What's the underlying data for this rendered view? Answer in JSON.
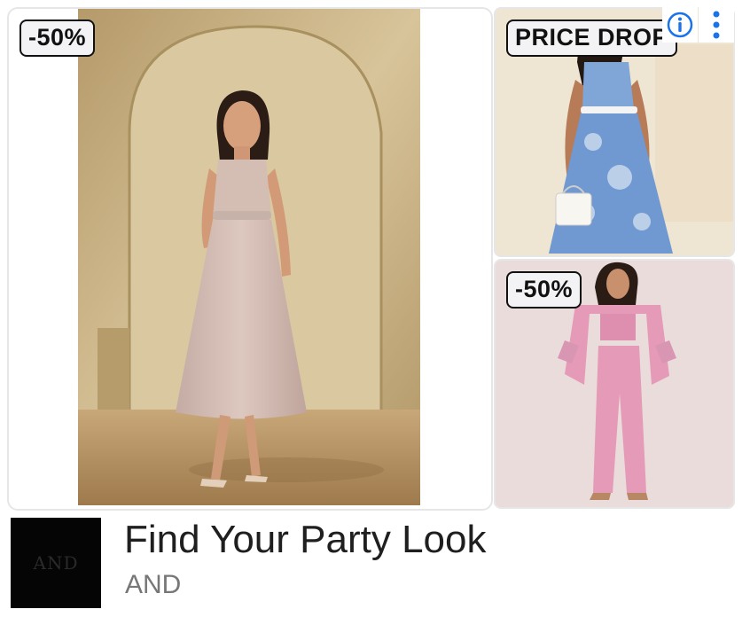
{
  "ad": {
    "main_badge": "-50%",
    "top_right_badge": "PRICE DROP",
    "bottom_right_badge": "-50%",
    "title": "Find Your Party Look",
    "advertiser": "AND",
    "logo_text": "AND"
  },
  "icons": {
    "info": "info-icon",
    "menu": "more-vertical-icon"
  },
  "colors": {
    "accent": "#1a73e8",
    "badge_bg": "#f3f3f6",
    "title": "#1f1f1f",
    "subtitle": "#777777"
  }
}
